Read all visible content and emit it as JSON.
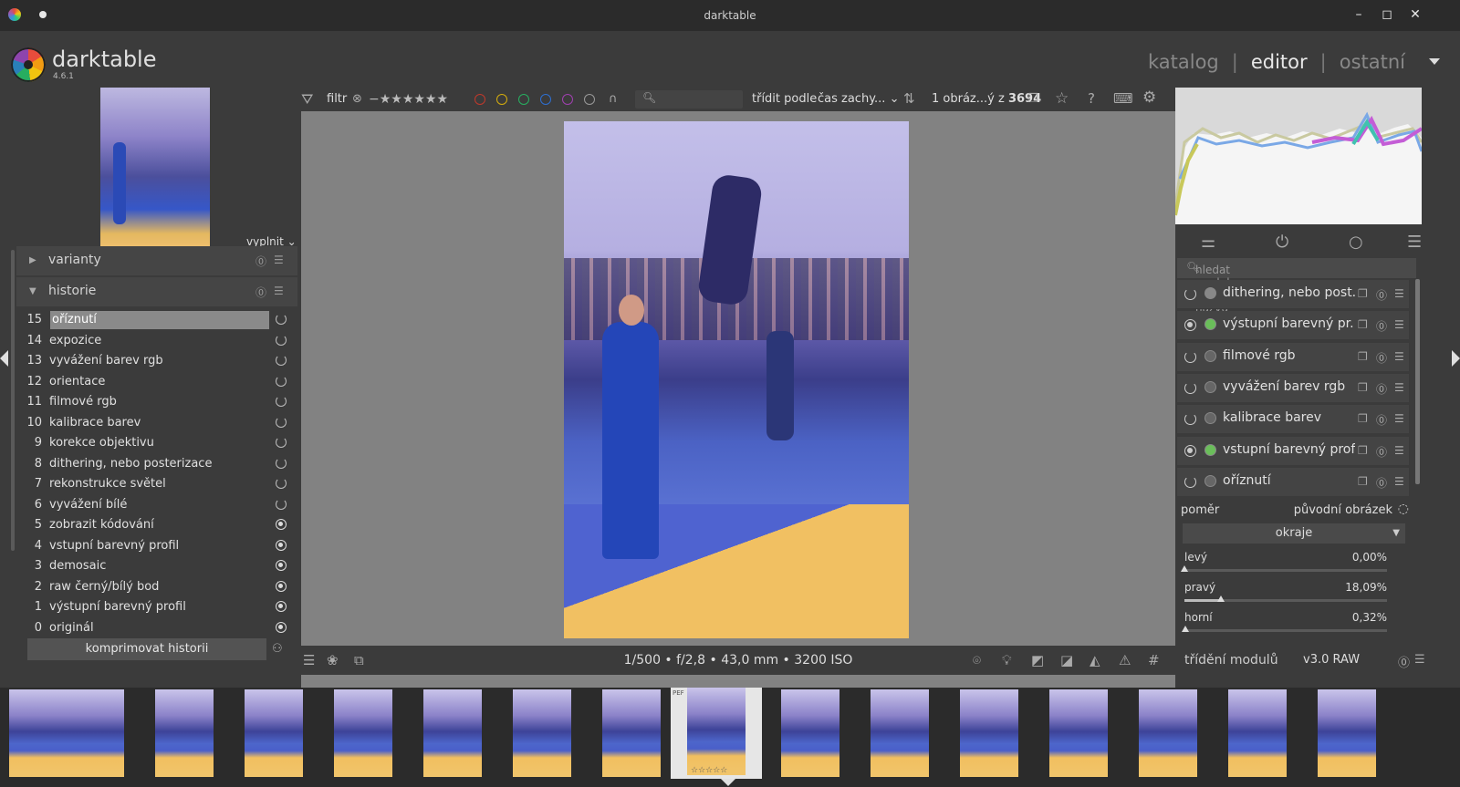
{
  "window": {
    "title": "darktable"
  },
  "app": {
    "name": "darktable",
    "version": "4.6.1"
  },
  "views": {
    "catalog": "katalog",
    "editor": "editor",
    "other": "ostatní",
    "separator": "|"
  },
  "left_panel": {
    "fill_label": "vyplnit",
    "sections": {
      "variants": "varianty",
      "history": "historie"
    },
    "history": [
      {
        "num": "15",
        "label": "oříznutí",
        "selected": true,
        "state": "off"
      },
      {
        "num": "14",
        "label": "expozice",
        "state": "off"
      },
      {
        "num": "13",
        "label": "vyvážení barev rgb",
        "state": "off"
      },
      {
        "num": "12",
        "label": "orientace",
        "state": "off"
      },
      {
        "num": "11",
        "label": "filmové rgb",
        "state": "off"
      },
      {
        "num": "10",
        "label": "kalibrace barev",
        "state": "off"
      },
      {
        "num": "9",
        "label": "korekce objektivu",
        "state": "off"
      },
      {
        "num": "8",
        "label": "dithering, nebo posterizace",
        "state": "off"
      },
      {
        "num": "7",
        "label": "rekonstrukce světel",
        "state": "off"
      },
      {
        "num": "6",
        "label": "vyvážení bílé",
        "state": "off"
      },
      {
        "num": "5",
        "label": "zobrazit kódování",
        "state": "on"
      },
      {
        "num": "4",
        "label": "vstupní barevný profil",
        "state": "on"
      },
      {
        "num": "3",
        "label": "demosaic",
        "state": "on"
      },
      {
        "num": "2",
        "label": "raw černý/bílý bod",
        "state": "on"
      },
      {
        "num": "1",
        "label": "výstupní barevný profil",
        "state": "on"
      },
      {
        "num": "0",
        "label": "originál",
        "state": "on"
      }
    ],
    "compress_button": "komprimovat historii"
  },
  "filter_bar": {
    "filter_label": "filtr",
    "sort_label": "třídit podle",
    "sort_value": "čas zachy...",
    "count_text": "1 obráz...ý z",
    "count_total": "3694",
    "color_labels": [
      "#c0392b",
      "#d4ac0d",
      "#27ae60",
      "#2e6fd1",
      "#a040b0",
      "#999999"
    ]
  },
  "info_bar": {
    "exif": "1/500 • f/2,8 • 43,0 mm • 3200 ISO"
  },
  "right_panel": {
    "search_placeholder": "hledat moduly podle názvu nebo štítku",
    "modules": [
      {
        "name": "dithering, nebo post...",
        "power": "off",
        "icon_color": "#888888"
      },
      {
        "name": "výstupní barevný pr...",
        "power": "on",
        "icon_color": "#6abe5a"
      },
      {
        "name": "filmové rgb",
        "power": "off",
        "icon_color": "#666666"
      },
      {
        "name": "vyvážení barev rgb",
        "power": "off",
        "icon_color": "#666666"
      },
      {
        "name": "kalibrace barev",
        "power": "off",
        "icon_color": "#666666"
      },
      {
        "name": "vstupní barevný profil",
        "power": "on",
        "icon_color": "#6abe5a"
      },
      {
        "name": "oříznutí",
        "power": "off",
        "icon_color": "#666666"
      }
    ],
    "ratio_label": "poměr",
    "ratio_value": "původní obrázek",
    "margins_header": "okraje",
    "sliders": [
      {
        "label": "levý",
        "value": "0,00%",
        "fraction": 0.0
      },
      {
        "label": "pravý",
        "value": "18,09%",
        "fraction": 0.1809
      },
      {
        "label": "horní",
        "value": "0,32%",
        "fraction": 0.0032
      }
    ],
    "bottom": {
      "module_sort": "třídění modulů",
      "preset": "v3.0 RAW"
    }
  },
  "filmstrip": {
    "current_badge": "PEF",
    "current_stars": "☆☆☆☆☆",
    "count": 16
  }
}
